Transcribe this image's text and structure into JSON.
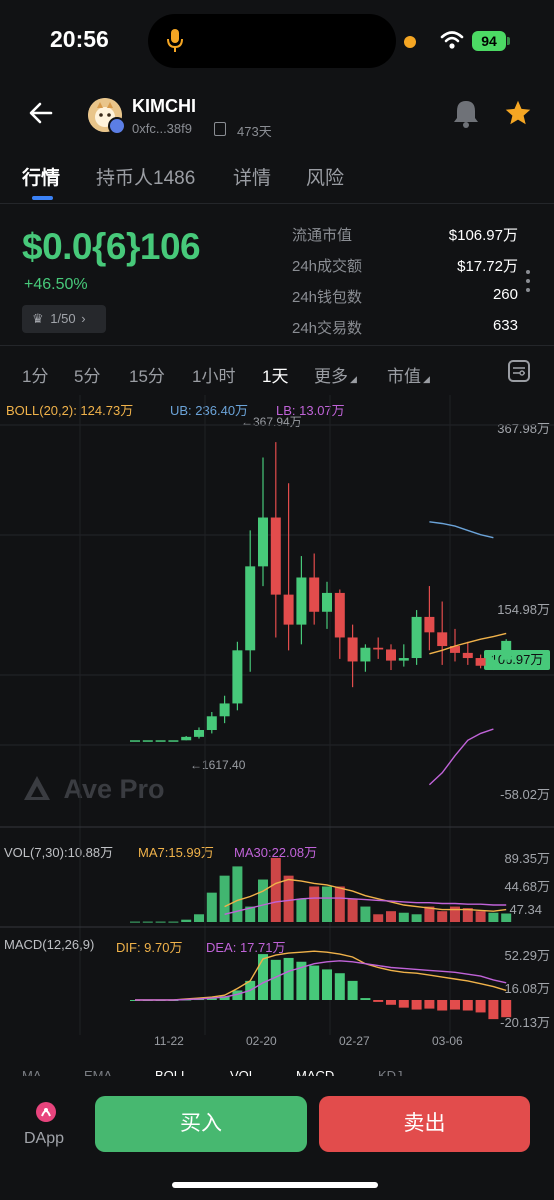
{
  "status_bar": {
    "time": "20:56",
    "battery": "94"
  },
  "header": {
    "token_name": "KIMCHI",
    "address": "0xfc...38f9",
    "age": "473天"
  },
  "tabs": [
    {
      "label": "行情",
      "active": true
    },
    {
      "label": "持币人1486",
      "active": false
    },
    {
      "label": "详情",
      "active": false
    },
    {
      "label": "风险",
      "active": false
    }
  ],
  "price": {
    "value": "$0.0{6}106",
    "change": "+46.50%",
    "rank": "1/50"
  },
  "stats": [
    {
      "label": "流通市值",
      "value": "$106.97万"
    },
    {
      "label": "24h成交额",
      "value": "$17.72万"
    },
    {
      "label": "24h钱包数",
      "value": "260"
    },
    {
      "label": "24h交易数",
      "value": "633"
    }
  ],
  "intervals": [
    "1分",
    "5分",
    "15分",
    "1小时",
    "1天",
    "更多",
    "市值"
  ],
  "active_interval": "1天",
  "indicators": {
    "boll": "BOLL(20,2): 124.73万",
    "ub": "UB: 236.40万",
    "lb": "LB: 13.07万",
    "vol": "VOL(7,30):10.88万",
    "ma7": "MA7:15.99万",
    "ma30": "MA30:22.08万",
    "macd": "MACD(12,26,9)",
    "dif": "DIF: 9.70万",
    "dea": "DEA: 17.71万"
  },
  "watermark": "Ave Pro",
  "current_price_tag": "106.97万",
  "colors": {
    "up": "#47c97a",
    "down": "#e24c4c",
    "ub": "#6ba3d8",
    "lb": "#c063d8",
    "mid": "#f0b24a"
  },
  "chart_data": [
    {
      "type": "candlestick",
      "title": "",
      "y_axis_labels": [
        "367.98万",
        "154.98万",
        "-58.02万"
      ],
      "annotations": [
        "←367.94万",
        "←1617.40"
      ],
      "current_value": "106.97万",
      "x_tick_labels": [
        "11-22",
        "02-20",
        "02-27",
        "03-06"
      ],
      "candles": [
        {
          "o": 0,
          "h": 0,
          "l": 0,
          "c": 0
        },
        {
          "o": 0,
          "h": 0,
          "l": 0,
          "c": 0
        },
        {
          "o": 0,
          "h": 0,
          "l": 0,
          "c": 0
        },
        {
          "o": 0,
          "h": 0,
          "l": 0,
          "c": 0
        },
        {
          "o": 0,
          "h": 5,
          "l": 0,
          "c": 4
        },
        {
          "o": 4,
          "h": 15,
          "l": 2,
          "c": 12
        },
        {
          "o": 12,
          "h": 33,
          "l": 8,
          "c": 28
        },
        {
          "o": 28,
          "h": 52,
          "l": 20,
          "c": 43
        },
        {
          "o": 43,
          "h": 115,
          "l": 35,
          "c": 105
        },
        {
          "o": 105,
          "h": 245,
          "l": 80,
          "c": 203
        },
        {
          "o": 203,
          "h": 330,
          "l": 180,
          "c": 260
        },
        {
          "o": 260,
          "h": 348,
          "l": 120,
          "c": 170
        },
        {
          "o": 170,
          "h": 300,
          "l": 105,
          "c": 135
        },
        {
          "o": 135,
          "h": 215,
          "l": 112,
          "c": 190
        },
        {
          "o": 190,
          "h": 218,
          "l": 135,
          "c": 150
        },
        {
          "o": 150,
          "h": 185,
          "l": 130,
          "c": 172
        },
        {
          "o": 172,
          "h": 176,
          "l": 95,
          "c": 120
        },
        {
          "o": 120,
          "h": 135,
          "l": 62,
          "c": 92
        },
        {
          "o": 92,
          "h": 112,
          "l": 80,
          "c": 108
        },
        {
          "o": 108,
          "h": 120,
          "l": 95,
          "c": 106
        },
        {
          "o": 106,
          "h": 112,
          "l": 82,
          "c": 93
        },
        {
          "o": 93,
          "h": 112,
          "l": 86,
          "c": 96
        },
        {
          "o": 96,
          "h": 152,
          "l": 88,
          "c": 144
        },
        {
          "o": 144,
          "h": 180,
          "l": 105,
          "c": 126
        },
        {
          "o": 126,
          "h": 162,
          "l": 88,
          "c": 110
        },
        {
          "o": 110,
          "h": 130,
          "l": 92,
          "c": 102
        },
        {
          "o": 102,
          "h": 115,
          "l": 88,
          "c": 96
        },
        {
          "o": 96,
          "h": 100,
          "l": 84,
          "c": 87
        },
        {
          "o": 87,
          "h": 100,
          "l": 82,
          "c": 94
        },
        {
          "o": 94,
          "h": 118,
          "l": 88,
          "c": 116
        }
      ],
      "ub": [
        null,
        null,
        null,
        null,
        null,
        null,
        null,
        null,
        null,
        null,
        null,
        null,
        null,
        null,
        null,
        null,
        null,
        null,
        null,
        null,
        null,
        null,
        null,
        255,
        253,
        250,
        245,
        240,
        236.4
      ],
      "mid": [
        null,
        null,
        null,
        null,
        null,
        null,
        null,
        null,
        null,
        null,
        null,
        null,
        null,
        null,
        null,
        null,
        null,
        null,
        null,
        null,
        null,
        null,
        null,
        101,
        105,
        110,
        114,
        118,
        121,
        124.7
      ],
      "lb": [
        null,
        null,
        null,
        null,
        null,
        null,
        null,
        null,
        null,
        null,
        null,
        null,
        null,
        null,
        null,
        null,
        null,
        null,
        null,
        null,
        null,
        null,
        null,
        -52,
        -38,
        -18,
        0,
        8,
        13.07
      ]
    },
    {
      "type": "bar",
      "title": "VOL",
      "y_axis_labels": [
        "89.35万",
        "44.68万",
        "47.34"
      ],
      "values": [
        0.5,
        0.5,
        0.5,
        0.5,
        3,
        10,
        38,
        60,
        72,
        20,
        55,
        83,
        60,
        30,
        46,
        46,
        46,
        30,
        20,
        10,
        14,
        12,
        10,
        20,
        14,
        20,
        18,
        14,
        12,
        11
      ],
      "ma7": [
        null,
        null,
        null,
        null,
        null,
        null,
        null,
        20,
        28,
        33,
        40,
        50,
        55,
        53,
        50,
        48,
        44,
        40,
        34,
        30,
        26,
        22,
        20,
        18,
        16,
        16,
        16,
        15,
        14,
        16
      ],
      "ma30": [
        null,
        null,
        null,
        null,
        null,
        null,
        null,
        10,
        14,
        18,
        22,
        26,
        28,
        30,
        31,
        31,
        31,
        30,
        29,
        28,
        27,
        26,
        25,
        25,
        24,
        24,
        23,
        23,
        22,
        22
      ]
    },
    {
      "type": "bar",
      "title": "MACD",
      "y_axis_labels": [
        "52.29万",
        "16.08万",
        "-20.13万"
      ],
      "hist": [
        0,
        0,
        0,
        0,
        0.5,
        1,
        2,
        4,
        10,
        20,
        48,
        42,
        44,
        40,
        36,
        32,
        28,
        20,
        2,
        -2,
        -5,
        -8,
        -10,
        -9,
        -11,
        -10,
        -11,
        -13,
        -20,
        -18
      ],
      "dif": [
        0,
        0,
        0,
        0,
        1,
        2,
        3,
        5,
        12,
        20,
        43,
        47,
        49,
        50,
        51,
        50,
        48,
        45,
        38,
        34,
        31,
        29,
        28,
        26,
        24,
        22,
        20,
        17,
        14,
        10
      ],
      "dea": [
        0,
        0,
        0,
        0,
        0.5,
        1,
        2,
        3,
        6,
        10,
        18,
        24,
        30,
        34,
        38,
        40,
        41,
        40,
        38,
        36,
        34,
        33,
        32,
        31,
        30,
        29,
        27,
        25,
        21,
        18
      ]
    }
  ],
  "bottom_indicator_tabs": [
    "MA",
    "EMA",
    "BOLL",
    "VOL",
    "MACD",
    "KDJ"
  ],
  "actions": {
    "dapp": "DApp",
    "buy": "买入",
    "sell": "卖出"
  }
}
